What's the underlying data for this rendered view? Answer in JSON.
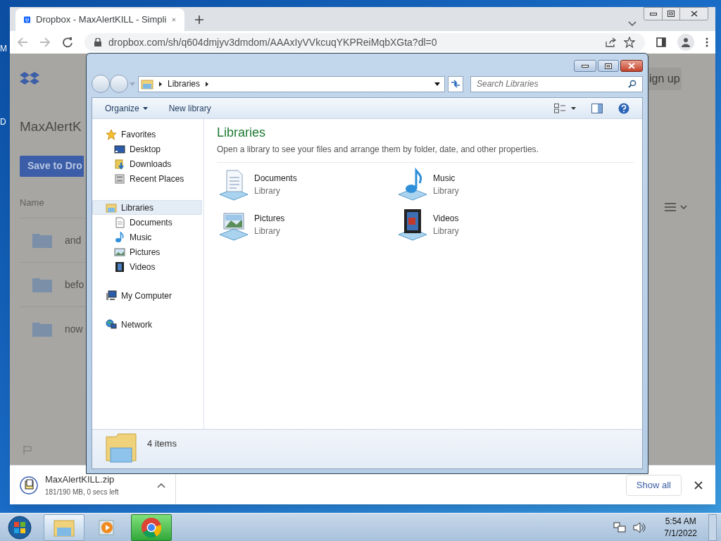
{
  "desktop": {
    "icon_labels": [
      "M",
      "D"
    ]
  },
  "browser": {
    "tab": {
      "title": "Dropbox - MaxAlertKILL - Simpli",
      "selected": true
    },
    "url": "dropbox.com/sh/q604dmjyv3dmdom/AAAxIyVVkcuqYKPReiMqbXGta?dl=0",
    "page": {
      "title": "MaxAlertK",
      "save_button": "Save to Dro",
      "sign_up": "ign up",
      "column": "Name",
      "rows": [
        "and",
        "befo",
        "now"
      ]
    },
    "download": {
      "file": "MaxAlertKILL.zip",
      "progress": "181/190 MB, 0 secs left",
      "show_all": "Show all"
    }
  },
  "explorer": {
    "breadcrumb": [
      "Libraries"
    ],
    "search_placeholder": "Search Libraries",
    "toolbar": [
      "Organize",
      "New library"
    ],
    "nav": [
      {
        "label": "Favorites",
        "kind": "star",
        "selected": false,
        "children": [
          {
            "label": "Desktop",
            "kind": "desktop",
            "selected": false
          },
          {
            "label": "Downloads",
            "kind": "downloads",
            "selected": false
          },
          {
            "label": "Recent Places",
            "kind": "recent",
            "selected": false
          }
        ]
      },
      {
        "label": "Libraries",
        "kind": "libraries",
        "selected": true,
        "children": [
          {
            "label": "Documents",
            "kind": "documents",
            "selected": false
          },
          {
            "label": "Music",
            "kind": "music",
            "selected": false
          },
          {
            "label": "Pictures",
            "kind": "pictures",
            "selected": false
          },
          {
            "label": "Videos",
            "kind": "videos",
            "selected": false
          }
        ]
      },
      {
        "label": "My Computer",
        "kind": "computer",
        "selected": false
      },
      {
        "label": "Network",
        "kind": "network",
        "selected": false
      }
    ],
    "heading": "Libraries",
    "description": "Open a library to see your files and arrange them by folder, date, and other properties.",
    "libraries": [
      {
        "name": "Documents",
        "type": "Library",
        "kind": "documents"
      },
      {
        "name": "Music",
        "type": "Library",
        "kind": "music"
      },
      {
        "name": "Pictures",
        "type": "Library",
        "kind": "pictures"
      },
      {
        "name": "Videos",
        "type": "Library",
        "kind": "videos"
      }
    ],
    "status": "4 items"
  },
  "taskbar": {
    "apps": [
      {
        "kind": "explorer",
        "running": true,
        "selected": false
      },
      {
        "kind": "media",
        "running": false,
        "selected": false
      },
      {
        "kind": "chrome",
        "running": true,
        "selected": true
      }
    ],
    "time": "5:54 AM",
    "date": "7/1/2022"
  }
}
